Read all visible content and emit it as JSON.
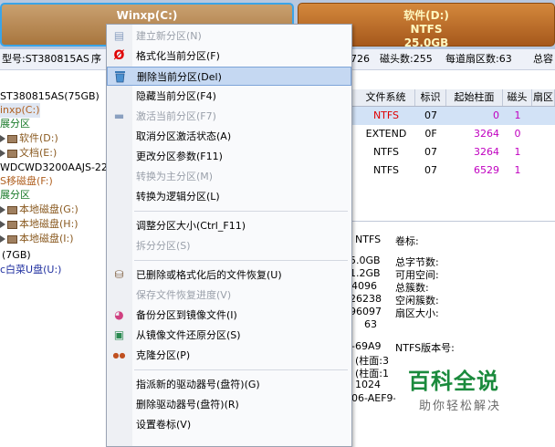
{
  "partitions": [
    {
      "name": "Winxp(C:)"
    },
    {
      "name": "软件(D:)",
      "fs": "NTFS",
      "size": "25.0GB"
    }
  ],
  "infobar": {
    "model": "型号:ST380815AS",
    "seq": "序",
    "num726": "726",
    "heads": "磁头数:255",
    "sectors": "每道扇区数:63",
    "cap": "总容"
  },
  "tree": [
    {
      "text": "ST380815AS(75GB)",
      "color": "#000000"
    },
    {
      "text": "inxp(C:)",
      "color": "#b06020"
    },
    {
      "text": "展分区",
      "color": "#1a7a2a"
    },
    {
      "text": "软件(D:)",
      "color": "#8a5a20"
    },
    {
      "text": "文档(E:)",
      "color": "#8a5a20"
    },
    {
      "text": "WDCWD3200AAJS-22",
      "color": "#000000"
    },
    {
      "text": "S移磁盘(F:)",
      "color": "#b06020"
    },
    {
      "text": "展分区",
      "color": "#1a7a2a"
    },
    {
      "text": "本地磁盘(G:)",
      "color": "#8a5a20"
    },
    {
      "text": "本地磁盘(H:)",
      "color": "#8a5a20"
    },
    {
      "text": "本地磁盘(I:)",
      "color": "#8a5a20"
    },
    {
      "text": "(7GB)",
      "color": "#000000"
    },
    {
      "text": "c白菜U盘(U:)",
      "color": "#2030a0"
    }
  ],
  "table": {
    "headers": [
      "文件系统",
      "标识",
      "起始柱面",
      "磁头",
      "扇区"
    ],
    "rows": [
      {
        "fs": "NTFS",
        "id": "07",
        "start": "0",
        "head": "1"
      },
      {
        "fs": "EXTEND",
        "id": "0F",
        "start": "3264",
        "head": "0"
      },
      {
        "fs": "NTFS",
        "id": "07",
        "start": "3264",
        "head": "1"
      },
      {
        "fs": "NTFS",
        "id": "07",
        "start": "6529",
        "head": "1"
      }
    ]
  },
  "details": {
    "fs_value": "NTFS",
    "volume_label": "卷标:",
    "values": [
      "5.0GB",
      "1.2GB",
      "4096",
      "26238",
      "96097",
      "63"
    ],
    "labels": [
      "总字节数:",
      "可用空间:",
      "总簇数:",
      "空闲簇数:",
      "扇区大小:"
    ],
    "serial_frag": "-69A9",
    "ntfs_ver": "NTFS版本号:",
    "cyl1": "(柱面:3",
    "cyl2": "(柱面:1",
    "num1024": "1024",
    "guid": "06-AEF9-"
  },
  "menu": {
    "items": [
      {
        "label": "建立新分区(N)",
        "disabled": true,
        "icon": "new-partition-icon",
        "glyph": "▤"
      },
      {
        "label": "格式化当前分区(F)",
        "disabled": false,
        "icon": "format-icon",
        "glyph": "Ø"
      },
      {
        "label": "删除当前分区(Del)",
        "disabled": false,
        "icon": "trash-icon",
        "glyph": "🗑",
        "selected": true
      },
      {
        "label": "隐藏当前分区(F4)",
        "disabled": false
      },
      {
        "label": "激活当前分区(F7)",
        "disabled": true,
        "icon": "activate-icon",
        "glyph": "▬"
      },
      {
        "label": "取消分区激活状态(A)",
        "disabled": false
      },
      {
        "label": "更改分区参数(F11)",
        "disabled": false
      },
      {
        "label": "转换为主分区(M)",
        "disabled": true
      },
      {
        "label": "转换为逻辑分区(L)",
        "disabled": false
      },
      {
        "label": "调整分区大小(Ctrl_F11)",
        "disabled": false
      },
      {
        "label": "拆分分区(S)",
        "disabled": true
      },
      {
        "label": "已删除或格式化后的文件恢复(U)",
        "disabled": false,
        "icon": "recover-icon",
        "glyph": "⛁"
      },
      {
        "label": "保存文件恢复进度(V)",
        "disabled": true
      },
      {
        "label": "备份分区到镜像文件(I)",
        "disabled": false,
        "icon": "backup-icon",
        "glyph": "◕"
      },
      {
        "label": "从镜像文件还原分区(S)",
        "disabled": false,
        "icon": "restore-icon",
        "glyph": "▣"
      },
      {
        "label": "克隆分区(P)",
        "disabled": false,
        "icon": "clone-icon",
        "glyph": "●●"
      },
      {
        "label": "指派新的驱动器号(盘符)(G)",
        "disabled": false
      },
      {
        "label": "删除驱动器号(盘符)(R)",
        "disabled": false
      },
      {
        "label": "设置卷标(V)",
        "disabled": false
      }
    ]
  },
  "watermark": {
    "title": "百科全说",
    "subtitle": "助你轻松解决"
  },
  "colors": {
    "selection": "#c5d8f2",
    "red_text": "#e00000",
    "magenta_value": "#c000c0",
    "accent_border": "#3aa4e8"
  }
}
